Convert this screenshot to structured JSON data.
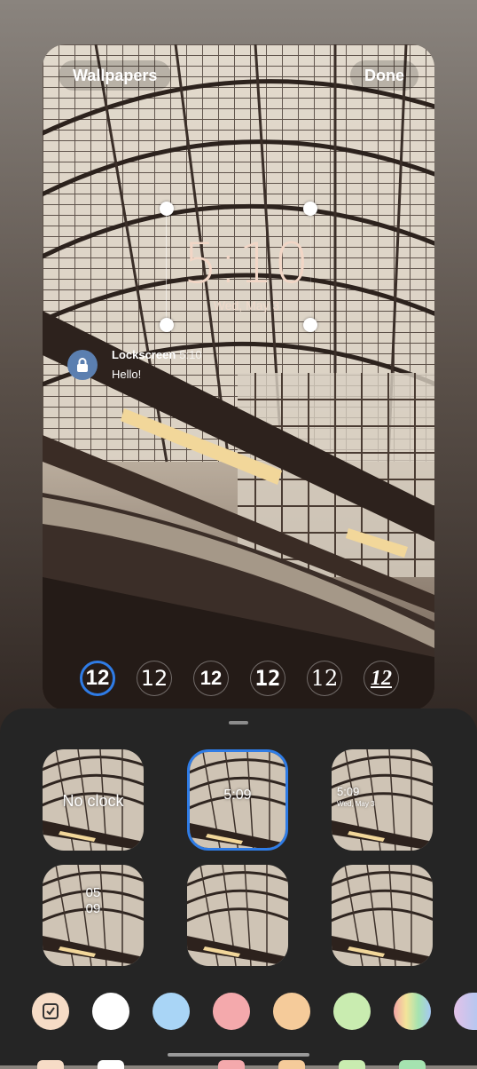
{
  "header": {
    "wallpapers_label": "Wallpapers",
    "done_label": "Done"
  },
  "lockscreen": {
    "time": "5:10",
    "date": "Wed, May 3",
    "notification": {
      "app": "Lockscreen",
      "time": "5:10",
      "message": "Hello!",
      "icon": "lock-icon"
    }
  },
  "clock_styles": {
    "items": [
      "12",
      "12",
      "12",
      "12",
      "12",
      "12"
    ],
    "selected_index": 0
  },
  "clock_layouts": {
    "no_clock_label": "No clock",
    "layout2_time": "5:09",
    "layout3_time": "5:09",
    "layout3_date": "Wed, May 3",
    "layout4_hour": "05",
    "layout4_min": "09",
    "selected_index": 1
  },
  "colors": {
    "picker_icon": "color-picker-icon",
    "swatches": [
      "#ffffff",
      "#a9d5f6",
      "#f4a9ac",
      "#f5cb9a",
      "#c9ecb0",
      "gradient-rainbow",
      "gradient-lavender"
    ],
    "selection_accent": "#2f7ce6"
  }
}
